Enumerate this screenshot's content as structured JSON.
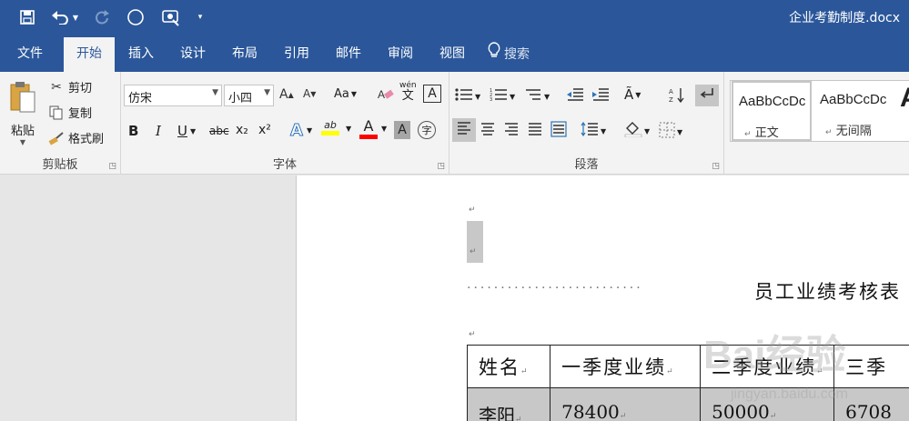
{
  "window": {
    "doc_title": "企业考勤制度.docx"
  },
  "quick_access": {
    "save_icon": "save-icon",
    "undo_icon": "undo-icon",
    "redo_icon": "redo-icon",
    "circle_icon": "circle-icon",
    "touch_icon": "touch-mode-icon",
    "customize_icon": "customize-qat-icon"
  },
  "tabs": [
    {
      "label": "文件"
    },
    {
      "label": "开始"
    },
    {
      "label": "插入"
    },
    {
      "label": "设计"
    },
    {
      "label": "布局"
    },
    {
      "label": "引用"
    },
    {
      "label": "邮件"
    },
    {
      "label": "审阅"
    },
    {
      "label": "视图"
    },
    {
      "label": "搜索"
    }
  ],
  "ribbon": {
    "clipboard": {
      "paste": "粘贴",
      "cut": "剪切",
      "copy": "复制",
      "format_painter": "格式刷",
      "label": "剪贴板"
    },
    "font": {
      "font_name": "仿宋",
      "font_size": "小四",
      "case_label": "Aa",
      "phonetic_top": "wén",
      "phonetic_bottom": "文",
      "border_char": "A",
      "bold": "B",
      "italic": "I",
      "underline": "U",
      "strike": "abc",
      "sub": "x₂",
      "sup": "x²",
      "text_effect": "A",
      "highlight": "ab",
      "font_color": "A",
      "shading": "A",
      "enclose": "字",
      "label": "字体"
    },
    "paragraph": {
      "label": "段落"
    },
    "styles": {
      "items": [
        {
          "sample": "AaBbCcDc",
          "name": "正文"
        },
        {
          "sample": "AaBbCcDc",
          "name": "无间隔"
        },
        {
          "sample": "A",
          "name": ""
        }
      ]
    }
  },
  "document": {
    "heading": "员工业绩考核表",
    "table": {
      "headers": [
        "姓名",
        "一季度业绩",
        "二季度业绩",
        "三季"
      ],
      "rows": [
        [
          "李阳",
          "78400",
          "50000",
          "6708"
        ]
      ]
    },
    "watermark_text": "Bai经验",
    "watermark_url": "jingyan.baidu.com"
  },
  "colors": {
    "brand": "#2b579a",
    "ribbon": "#f3f3f3",
    "highlight_yellow": "#ffff00",
    "font_red": "#ff0000"
  }
}
